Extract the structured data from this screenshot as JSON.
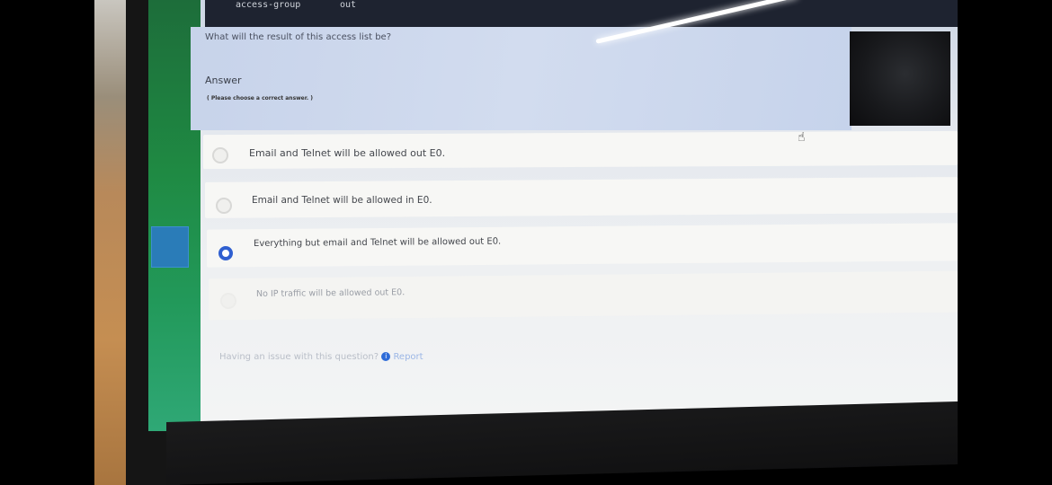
{
  "terminal": {
    "line_left": "access-group",
    "line_right": "out"
  },
  "question": {
    "text": "What will the result of this access list be?",
    "answer_label": "Answer",
    "answer_hint": "( Please choose a correct answer. )"
  },
  "options": [
    {
      "text": "Email and Telnet will be allowed out E0.",
      "selected": false
    },
    {
      "text": "Email and Telnet will be allowed in E0.",
      "selected": false
    },
    {
      "text": "Everything but email and Telnet will be allowed out E0.",
      "selected": true
    },
    {
      "text": "No IP traffic will be allowed out E0.",
      "selected": false
    }
  ],
  "footer": {
    "issue_text": "Having an issue with this question?",
    "report_label": "Report",
    "info_icon": "info-icon"
  },
  "colors": {
    "selected_radio": "#2f5fd0",
    "sidebar": "#1f8a43",
    "header_band": "#cfd9ec"
  },
  "cursor": {
    "icon": "hand-pointer-icon"
  }
}
